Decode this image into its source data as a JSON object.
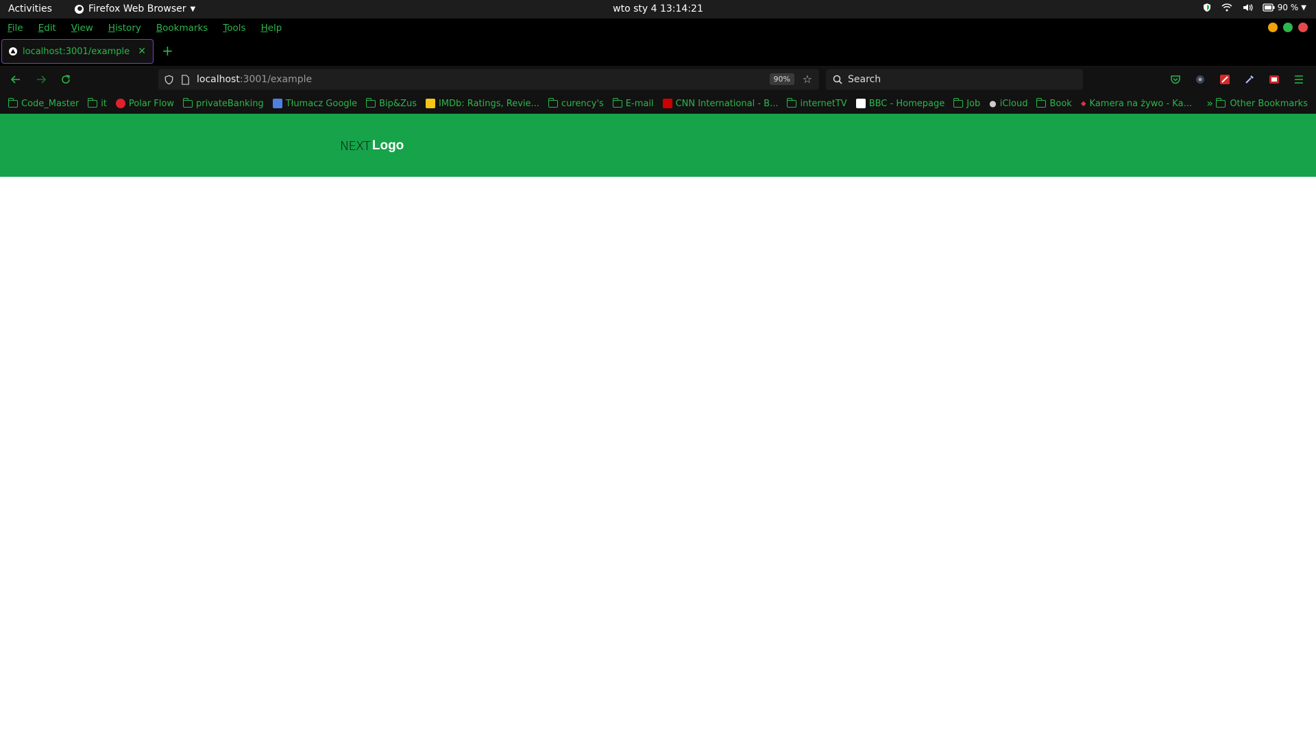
{
  "system": {
    "activities": "Activities",
    "app_name": "Firefox Web Browser",
    "clock": "wto sty 4  13:14:21",
    "battery": "90 %"
  },
  "menubar": {
    "items": [
      "File",
      "Edit",
      "View",
      "History",
      "Bookmarks",
      "Tools",
      "Help"
    ]
  },
  "tabs": [
    {
      "title": "localhost:3001/example",
      "active": true
    }
  ],
  "navbar": {
    "url_host": "localhost",
    "url_path": ":3001/example",
    "zoom": "90%",
    "search_placeholder": "Search"
  },
  "bookmarks": {
    "items": [
      {
        "label": "Code_Master",
        "icon": "folder"
      },
      {
        "label": "it",
        "icon": "folder"
      },
      {
        "label": "Polar Flow",
        "icon": "polar",
        "color": "#e0202a"
      },
      {
        "label": "privateBanking",
        "icon": "folder"
      },
      {
        "label": "Tłumacz Google",
        "icon": "translate",
        "color": "#4f7fe0"
      },
      {
        "label": "Bip&Zus",
        "icon": "folder"
      },
      {
        "label": "IMDb: Ratings, Revie...",
        "icon": "imdb",
        "color": "#f5c518"
      },
      {
        "label": "curency's",
        "icon": "folder"
      },
      {
        "label": "E-mail",
        "icon": "folder"
      },
      {
        "label": "CNN International - B...",
        "icon": "cnn",
        "color": "#cc0000"
      },
      {
        "label": "internetTV",
        "icon": "folder"
      },
      {
        "label": "BBC - Homepage",
        "icon": "bbc",
        "color": "#ffffff"
      },
      {
        "label": "Job",
        "icon": "folder"
      },
      {
        "label": "iCloud",
        "icon": "apple",
        "color": "#cccccc"
      },
      {
        "label": "Book",
        "icon": "folder"
      },
      {
        "label": "Kamera na żywo - Ka...",
        "icon": "camera",
        "color": "#d9363e"
      }
    ],
    "other": "Other Bookmarks"
  },
  "page": {
    "header_color": "#16a34a",
    "logo_mark": "NEXT",
    "logo_text": "Logo"
  }
}
